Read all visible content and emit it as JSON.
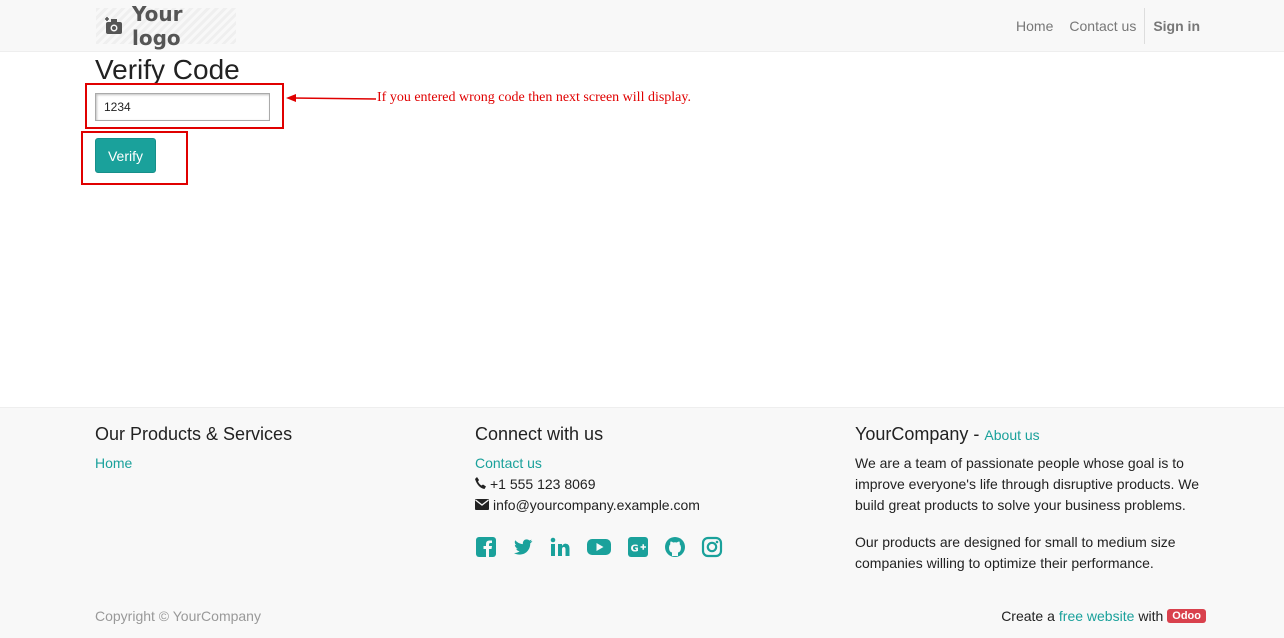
{
  "header": {
    "logo_text": "Your logo",
    "nav": [
      "Home",
      "Contact us"
    ],
    "sign_in": "Sign in"
  },
  "main": {
    "title": "Verify Code",
    "code_value": "1234",
    "verify_label": "Verify",
    "annotation": "If you entered wrong code then next screen will display.",
    "annotation_color": "#e00000"
  },
  "footer": {
    "col1": {
      "heading": "Our Products & Services",
      "links": [
        "Home"
      ]
    },
    "col2": {
      "heading": "Connect with us",
      "contact_link": "Contact us",
      "phone": "+1 555 123 8069",
      "email": "info@yourcompany.example.com",
      "social_icons": [
        "facebook-icon",
        "twitter-icon",
        "linkedin-icon",
        "youtube-icon",
        "google-plus-icon",
        "github-icon",
        "instagram-icon"
      ]
    },
    "col3": {
      "company": "YourCompany",
      "separator": " - ",
      "about_link": "About us",
      "para1": "We are a team of passionate people whose goal is to improve everyone's life through disruptive products. We build great products to solve your business problems.",
      "para2": "Our products are designed for small to medium size companies willing to optimize their performance."
    },
    "copyright": "Copyright © YourCompany",
    "create_prefix": "Create a",
    "free_website": "free website",
    "create_with": "with",
    "odoo_badge": "Odoo"
  },
  "colors": {
    "accent": "#1aa19b",
    "badge": "#d9414d"
  }
}
